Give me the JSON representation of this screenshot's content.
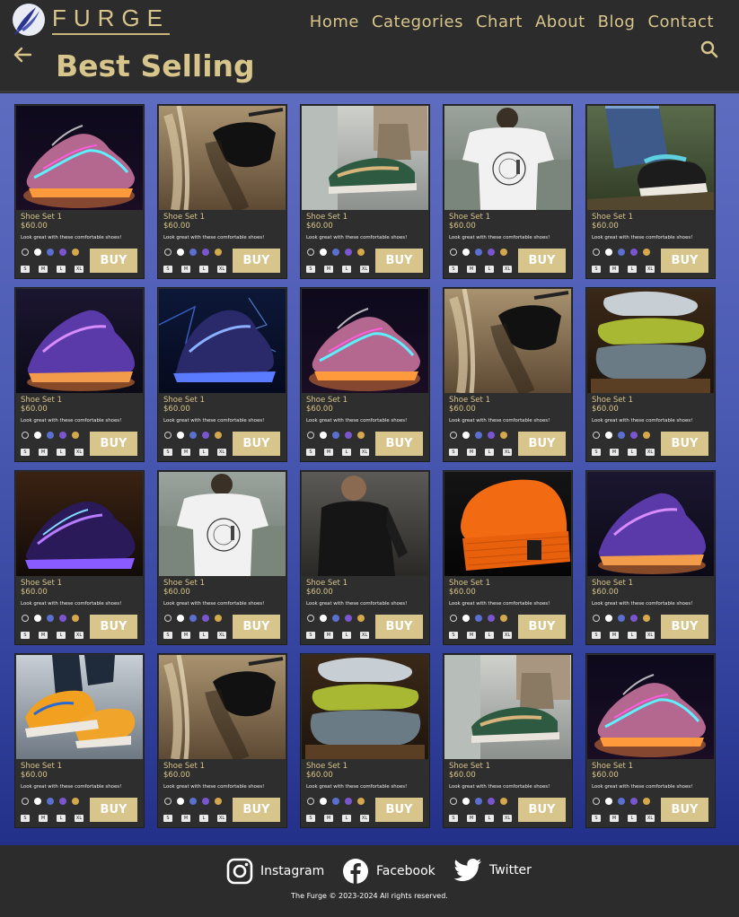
{
  "header": {
    "logo_text": "FURGE",
    "nav": [
      "Home",
      "Categories",
      "Chart",
      "About",
      "Blog",
      "Contact"
    ],
    "page_title": "Best Selling"
  },
  "colors": {
    "gold": "#d8c58b",
    "panel": "#2c2c2c",
    "swatches": [
      "#2e2e2e",
      "#ffffff",
      "#5b6fd0",
      "#7a55d0",
      "#d4a84c"
    ]
  },
  "products": [
    {
      "name": "Shoe Set 1",
      "price": "$60.00",
      "desc": "Look great with these comfortable shoes!",
      "image": "neon-sneaker"
    },
    {
      "name": "Shoe Set 1",
      "price": "$60.00",
      "desc": "Look great with these comfortable shoes!",
      "image": "sunglasses"
    },
    {
      "name": "Shoe Set 1",
      "price": "$60.00",
      "desc": "Look great with these comfortable shoes!",
      "image": "green-skate-shoe"
    },
    {
      "name": "Shoe Set 1",
      "price": "$60.00",
      "desc": "Look great with these comfortable shoes!",
      "image": "white-tshirt"
    },
    {
      "name": "Shoe Set 1",
      "price": "$60.00",
      "desc": "Look great with these comfortable shoes!",
      "image": "jeans-sneaker"
    },
    {
      "name": "Shoe Set 1",
      "price": "$60.00",
      "desc": "Look great with these comfortable shoes!",
      "image": "purple-sneaker"
    },
    {
      "name": "Shoe Set 1",
      "price": "$60.00",
      "desc": "Look great with these comfortable shoes!",
      "image": "blue-neon-boot"
    },
    {
      "name": "Shoe Set 1",
      "price": "$60.00",
      "desc": "Look great with these comfortable shoes!",
      "image": "neon-sneaker"
    },
    {
      "name": "Shoe Set 1",
      "price": "$60.00",
      "desc": "Look great with these comfortable shoes!",
      "image": "sunglasses"
    },
    {
      "name": "Shoe Set 1",
      "price": "$60.00",
      "desc": "Look great with these comfortable shoes!",
      "image": "scarves"
    },
    {
      "name": "Shoe Set 1",
      "price": "$60.00",
      "desc": "Look great with these comfortable shoes!",
      "image": "purple-neon-sneaker"
    },
    {
      "name": "Shoe Set 1",
      "price": "$60.00",
      "desc": "Look great with these comfortable shoes!",
      "image": "white-tshirt"
    },
    {
      "name": "Shoe Set 1",
      "price": "$60.00",
      "desc": "Look great with these comfortable shoes!",
      "image": "black-sweater"
    },
    {
      "name": "Shoe Set 1",
      "price": "$60.00",
      "desc": "Look great with these comfortable shoes!",
      "image": "orange-beanie"
    },
    {
      "name": "Shoe Set 1",
      "price": "$60.00",
      "desc": "Look great with these comfortable shoes!",
      "image": "purple-sneaker"
    },
    {
      "name": "Shoe Set 1",
      "price": "$60.00",
      "desc": "Look great with these comfortable shoes!",
      "image": "orange-sneaker"
    },
    {
      "name": "Shoe Set 1",
      "price": "$60.00",
      "desc": "Look great with these comfortable shoes!",
      "image": "sunglasses"
    },
    {
      "name": "Shoe Set 1",
      "price": "$60.00",
      "desc": "Look great with these comfortable shoes!",
      "image": "scarves"
    },
    {
      "name": "Shoe Set 1",
      "price": "$60.00",
      "desc": "Look great with these comfortable shoes!",
      "image": "green-skate-shoe"
    },
    {
      "name": "Shoe Set 1",
      "price": "$60.00",
      "desc": "Look great with these comfortable shoes!",
      "image": "neon-sneaker"
    }
  ],
  "sizes": [
    "S",
    "M",
    "L",
    "XL"
  ],
  "buy_label": "BUY",
  "footer": {
    "social": [
      {
        "label": "Instagram",
        "icon": "instagram-icon"
      },
      {
        "label": "Facebook",
        "icon": "facebook-icon"
      },
      {
        "label": "Twitter",
        "icon": "twitter-icon"
      }
    ],
    "copyright": "The Furge © 2023-2024 All rights reserved."
  }
}
